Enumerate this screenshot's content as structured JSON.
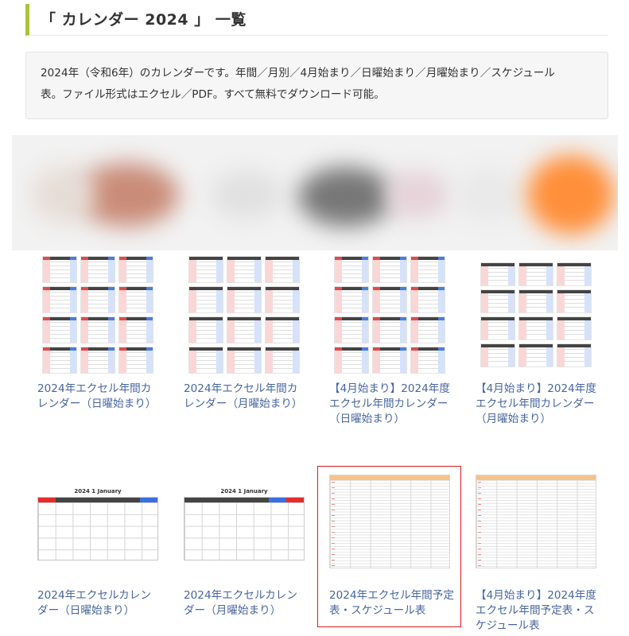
{
  "heading": {
    "title": "「 カレンダー 2024 」 一覧"
  },
  "description": {
    "line1": "2024年（令和6年）のカレンダーです。年間／月別／4月始まり／日曜始まり／月曜始まり／スケジュール",
    "line2": "表。ファイル形式はエクセル／PDF。すべて無料でダウンロード可能。"
  },
  "colors": {
    "accent_bar": "#a9c43a",
    "link": "#4766a0",
    "highlight_border": "#d81b25"
  },
  "cards_row1": [
    {
      "title": "2024年エクセル年間カレンダー（日曜始まり）",
      "thumb": "annual-calendar"
    },
    {
      "title": "2024年エクセル年間カレンダー（月曜始まり）",
      "thumb": "annual-calendar"
    },
    {
      "title": "【4月始まり】2024年度エクセル年間カレンダー（日曜始まり）",
      "thumb": "annual-calendar"
    },
    {
      "title": "【4月始まり】2024年度エクセル年間カレンダー（月曜始まり）",
      "thumb": "annual-calendar"
    }
  ],
  "cards_row2": [
    {
      "title": "2024年エクセルカレンダー（日曜始まり）",
      "thumb": "monthly-calendar",
      "thumb_caption": "2024    1    January"
    },
    {
      "title": "2024年エクセルカレンダー（月曜始まり）",
      "thumb": "monthly-calendar",
      "thumb_caption": "2024    1    January"
    },
    {
      "title": "2024年エクセル年間予定表・スケジュール表",
      "thumb": "schedule",
      "selected": true
    },
    {
      "title": "【4月始まり】2024年度エクセル年間予定表・スケジュール表",
      "thumb": "schedule"
    }
  ]
}
